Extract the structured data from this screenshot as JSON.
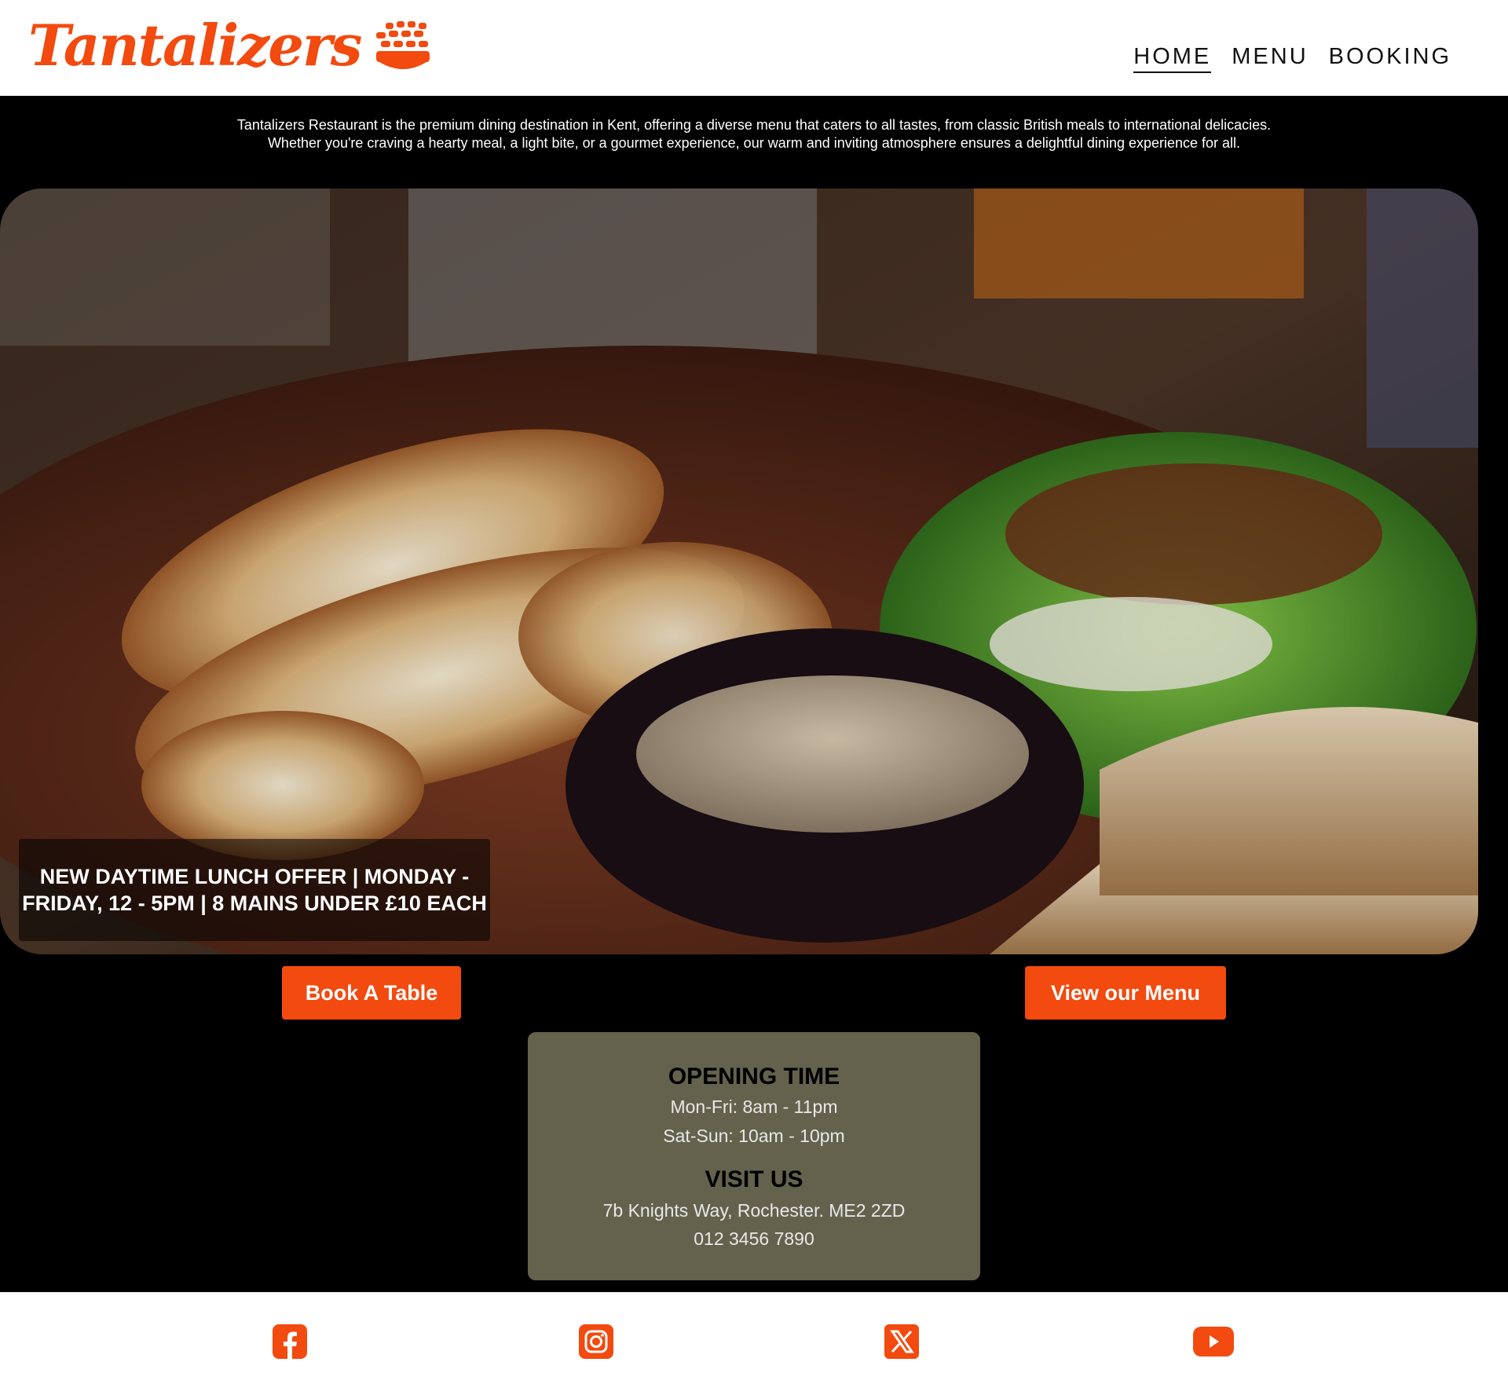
{
  "brand": {
    "name": "Tantalizers",
    "accent_color": "#f24a0f",
    "logo_icon": "bread-basket-icon"
  },
  "nav": {
    "items": [
      {
        "label": "HOME",
        "active": true
      },
      {
        "label": "MENU",
        "active": false
      },
      {
        "label": "BOOKING",
        "active": false
      }
    ]
  },
  "intro": {
    "text": "Tantalizers Restaurant is the premium dining destination in Kent, offering a diverse menu that caters to all tastes, from classic British meals to international delicacies. Whether you're craving a hearty meal, a light bite, or a gourmet experience, our warm and inviting atmosphere ensures a delightful dining experience for all."
  },
  "hero": {
    "offer_text": "NEW DAYTIME LUNCH OFFER | MONDAY - FRIDAY, 12 - 5PM | 8 MAINS UNDER £10 EACH"
  },
  "buttons": {
    "book": "Book A Table",
    "menu": "View our Menu"
  },
  "info": {
    "opening_heading": "OPENING TIME",
    "weekday_hours": "Mon-Fri: 8am - 11pm",
    "weekend_hours": "Sat-Sun: 10am - 10pm",
    "visit_heading": "VISIT US",
    "address": "7b Knights Way, Rochester. ME2 2ZD",
    "phone": "012 3456 7890",
    "box_color": "#64624d"
  },
  "footer": {
    "social": [
      {
        "icon": "facebook-icon"
      },
      {
        "icon": "instagram-icon"
      },
      {
        "icon": "x-twitter-icon"
      },
      {
        "icon": "youtube-icon"
      }
    ]
  }
}
